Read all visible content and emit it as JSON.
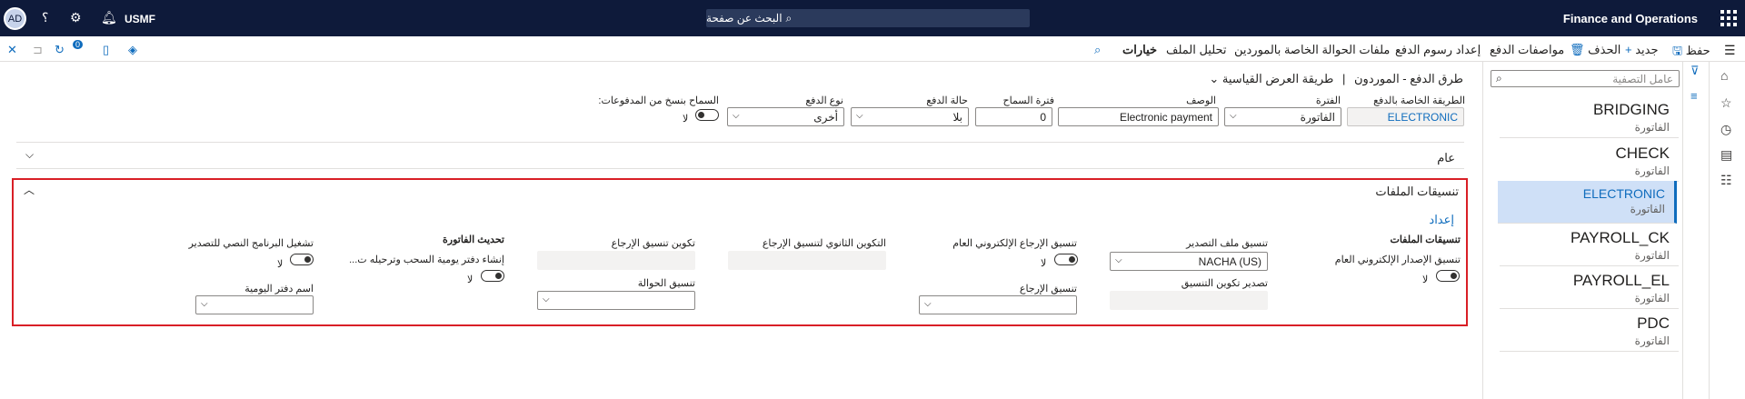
{
  "topbar": {
    "app_title": "Finance and Operations",
    "search_placeholder": "البحث عن صفحة",
    "company": "USMF",
    "avatar_initials": "AD",
    "icons": [
      "waffle-icon",
      "search-icon",
      "bell-icon",
      "gear-icon",
      "help-icon"
    ]
  },
  "actions": {
    "save": "حفظ",
    "new": "جديد",
    "delete": "الحذف",
    "payment_specs": "مواصفات الدفع",
    "payment_fees": "إعداد رسوم الدفع",
    "vendor_remittance": "ملفات الحوالة الخاصة بالموردين",
    "file_analysis": "تحليل الملف",
    "options": "خيارات",
    "badge_count": "0"
  },
  "list_pane": {
    "filter_placeholder": "عامل التصفية",
    "items": [
      {
        "code": "BRIDGING",
        "sub": "الفاتورة"
      },
      {
        "code": "CHECK",
        "sub": "الفاتورة"
      },
      {
        "code": "ELECTRONIC",
        "sub": "الفاتورة"
      },
      {
        "code": "PAYROLL_CK",
        "sub": "الفاتورة"
      },
      {
        "code": "PAYROLL_EL",
        "sub": "الفاتورة"
      },
      {
        "code": "PDC",
        "sub": "الفاتورة"
      }
    ]
  },
  "breadcrumb": {
    "page": "طرق الدفع - الموردون",
    "separator": "|",
    "view": "طريقة العرض القياسية"
  },
  "header_fields": {
    "method_label": "الطريقة الخاصة بالدفع",
    "method_value": "ELECTRONIC",
    "period_label": "الفترة",
    "period_value": "الفاتورة",
    "description_label": "الوصف",
    "description_value": "Electronic payment",
    "grace_label": "فترة السماح",
    "grace_value": "0",
    "status_label": "حالة الدفع",
    "status_value": "بلا",
    "type_label": "نوع الدفع",
    "type_value": "أخرى",
    "allow_copy_label": "السماح بنسخ من المدفوعات:",
    "allow_copy_value": "لا"
  },
  "general_tab": {
    "title": "عام"
  },
  "file_formats_tab": {
    "title": "تنسيقات الملفات",
    "setup_link": "إعداد",
    "section_label": "تنسيقات الملفات",
    "generic_export_label": "تنسيق الإصدار الإلكتروني العام",
    "generic_export_value": "لا",
    "export_format_label": "تنسيق ملف التصدير",
    "export_format_value": "NACHA (US)",
    "export_config_label": "تصدير تكوين التنسيق",
    "generic_return_label": "تنسيق الإرجاع الإلكتروني العام",
    "generic_return_value": "لا",
    "return_format_label": "تنسيق الإرجاع",
    "secondary_return_label": "التكوين الثانوي لتنسيق الإرجاع",
    "return_config_label": "تكوين تنسيق الإرجاع",
    "remittance_label": "تنسيق الحوالة",
    "update_invoice_label": "تحديث الفاتورة",
    "create_journal_label": "إنشاء دفتر يومية السحب وترحيله ت...",
    "create_journal_value": "لا",
    "run_script_label": "تشغيل البرنامج النصي للتصدير",
    "run_script_value": "لا",
    "journal_name_label": "اسم دفتر اليومية"
  }
}
